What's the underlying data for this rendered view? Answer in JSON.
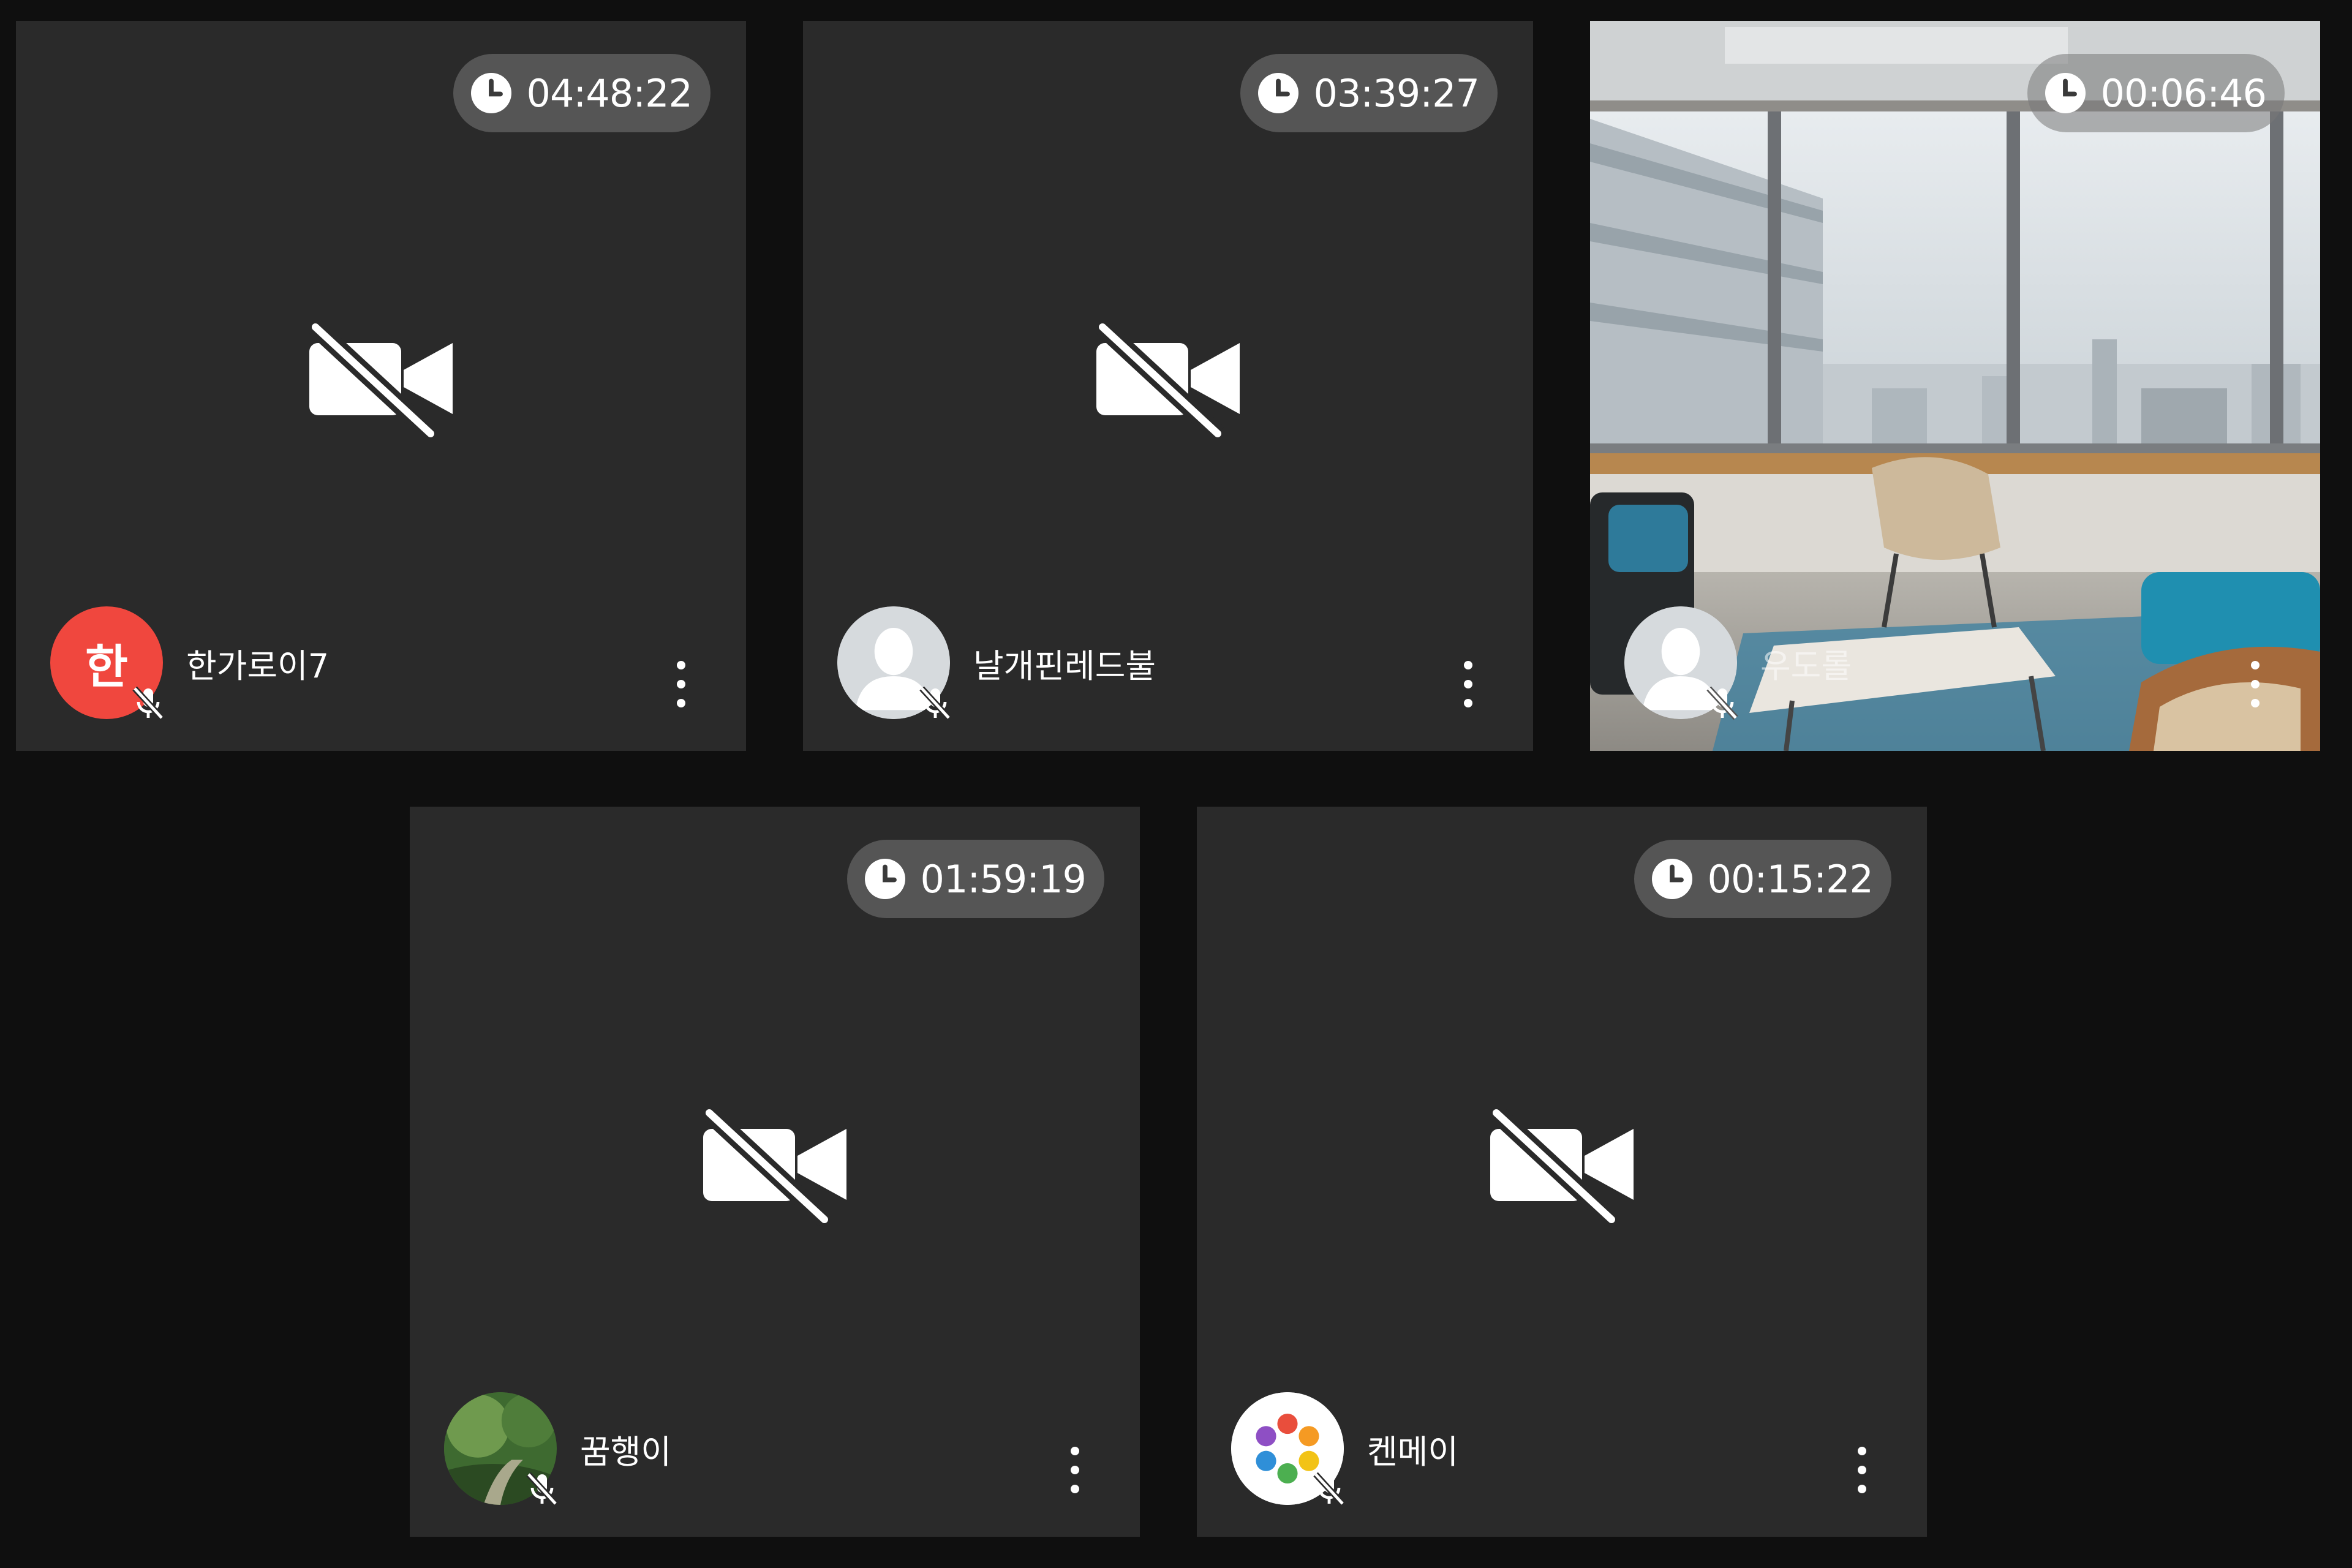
{
  "tiles": [
    {
      "timer": "04:48:22",
      "name": "한가로이7",
      "avatar_type": "initial",
      "avatar_initial": "한",
      "avatar_color": "#f0473e",
      "video": "off"
    },
    {
      "timer": "03:39:27",
      "name": "날개핀레드불",
      "avatar_type": "default-person",
      "video": "off"
    },
    {
      "timer": "00:06:46",
      "name": "우도롤",
      "avatar_type": "default-person",
      "video": "virtual-background-office"
    },
    {
      "timer": "01:59:19",
      "name": "꿈행이",
      "avatar_type": "photo-nature",
      "video": "off"
    },
    {
      "timer": "00:15:22",
      "name": "켄메이",
      "avatar_type": "logo",
      "video": "off"
    }
  ],
  "icons": {
    "timer": "clock-icon",
    "camera": "video-off-icon",
    "mic": "mic-off-icon",
    "menu": "more-vertical-icon",
    "avatar_default": "person-silhouette-icon"
  },
  "colors": {
    "background": "#0f0f0f",
    "tile": "#2a2a2a",
    "timer_pill": "#787878",
    "accent_red": "#f0473e"
  }
}
